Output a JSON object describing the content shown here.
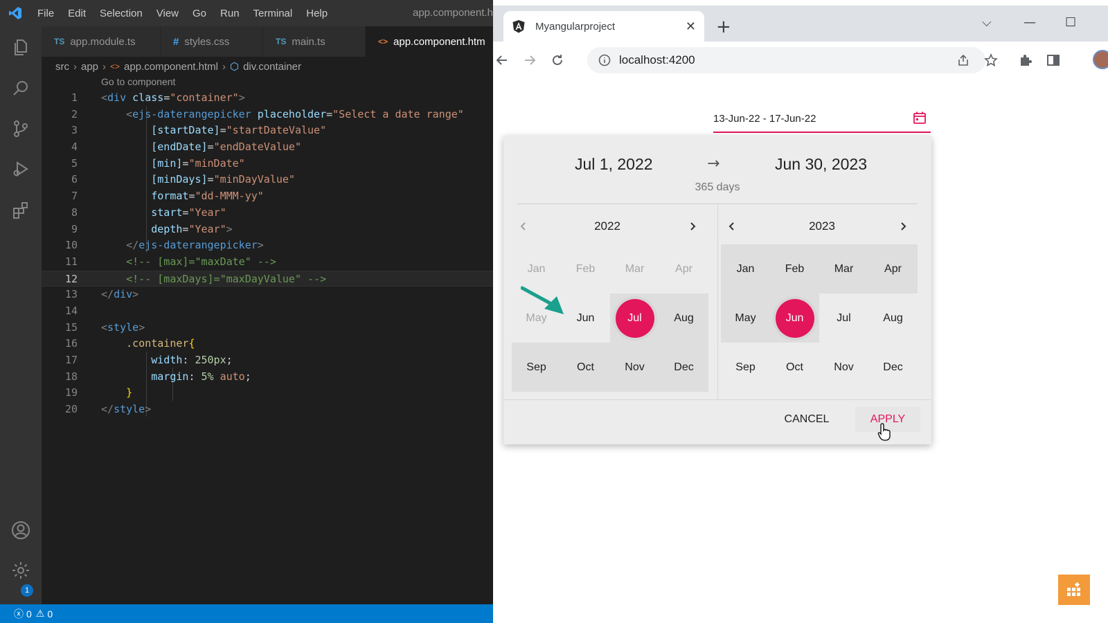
{
  "vscode": {
    "menu": [
      "File",
      "Edit",
      "Selection",
      "View",
      "Go",
      "Run",
      "Terminal",
      "Help"
    ],
    "window_title": "app.component.h",
    "tabs": [
      {
        "icon": "TS",
        "label": "app.module.ts"
      },
      {
        "icon": "#",
        "label": "styles.css"
      },
      {
        "icon": "TS",
        "label": "main.ts"
      },
      {
        "icon": "<>",
        "label": "app.component.htm"
      }
    ],
    "breadcrumb": [
      "src",
      "app",
      "app.component.html",
      "div.container"
    ],
    "codelens": "Go to component",
    "line_numbers": [
      "1",
      "2",
      "3",
      "4",
      "5",
      "6",
      "7",
      "8",
      "9",
      "10",
      "11",
      "12",
      "13",
      "14",
      "15",
      "16",
      "17",
      "18",
      "19",
      "20"
    ],
    "code": {
      "l1": {
        "a": "<",
        "b": "div",
        "c": "class",
        "d": "=",
        "e": "\"container\"",
        "f": ">"
      },
      "l2": {
        "a": "<",
        "b": "ejs-daterangepicker",
        "c": "placeholder",
        "d": "=",
        "e": "\"Select a date range\""
      },
      "l3": {
        "c": "[startDate]",
        "d": "=",
        "e": "\"startDateValue\""
      },
      "l4": {
        "c": "[endDate]",
        "d": "=",
        "e": "\"endDateValue\""
      },
      "l5": {
        "c": "[min]",
        "d": "=",
        "e": "\"minDate\""
      },
      "l6": {
        "c": "[minDays]",
        "d": "=",
        "e": "\"minDayValue\""
      },
      "l7": {
        "c": "format",
        "d": "=",
        "e": "\"dd-MMM-yy\""
      },
      "l8": {
        "c": "start",
        "d": "=",
        "e": "\"Year\""
      },
      "l9": {
        "c": "depth",
        "d": "=",
        "e": "\"Year\"",
        "f": ">"
      },
      "l10": {
        "a": "</",
        "b": "ejs-daterangepicker",
        "f": ">"
      },
      "l11": "<!-- [max]=\"maxDate\" -->",
      "l12": "<!-- [maxDays]=\"maxDayValue\" -->",
      "l13": {
        "a": "</",
        "b": "div",
        "f": ">"
      },
      "l15": {
        "a": "<",
        "b": "style",
        "f": ">"
      },
      "l16": {
        "sel": ".container",
        "brace": "{"
      },
      "l17": {
        "prop": "width",
        "colon": ": ",
        "val": "250px",
        "semi": ";"
      },
      "l18": {
        "prop": "margin",
        "colon": ": ",
        "val": "5%",
        "val2": " auto",
        "semi": ";"
      },
      "l19": {
        "brace": "}"
      },
      "l20": {
        "a": "</",
        "b": "style",
        "f": ">"
      }
    },
    "status": {
      "errors": "0",
      "warnings": "0"
    },
    "settings_badge": "1"
  },
  "browser": {
    "tab_title": "Myangularproject",
    "url": "localhost:4200"
  },
  "picker": {
    "input_value": "13-Jun-22 - 17-Jun-22",
    "start_label": "Jul 1, 2022",
    "end_label": "Jun 30, 2023",
    "arrow": "→",
    "days": "365 days",
    "left_year": "2022",
    "right_year": "2023",
    "months": [
      "Jan",
      "Feb",
      "Mar",
      "Apr",
      "May",
      "Jun",
      "Jul",
      "Aug",
      "Sep",
      "Oct",
      "Nov",
      "Dec"
    ],
    "cancel": "CANCEL",
    "apply": "APPLY"
  },
  "colors": {
    "accent": "#e3165b",
    "statusbar": "#007acc"
  }
}
